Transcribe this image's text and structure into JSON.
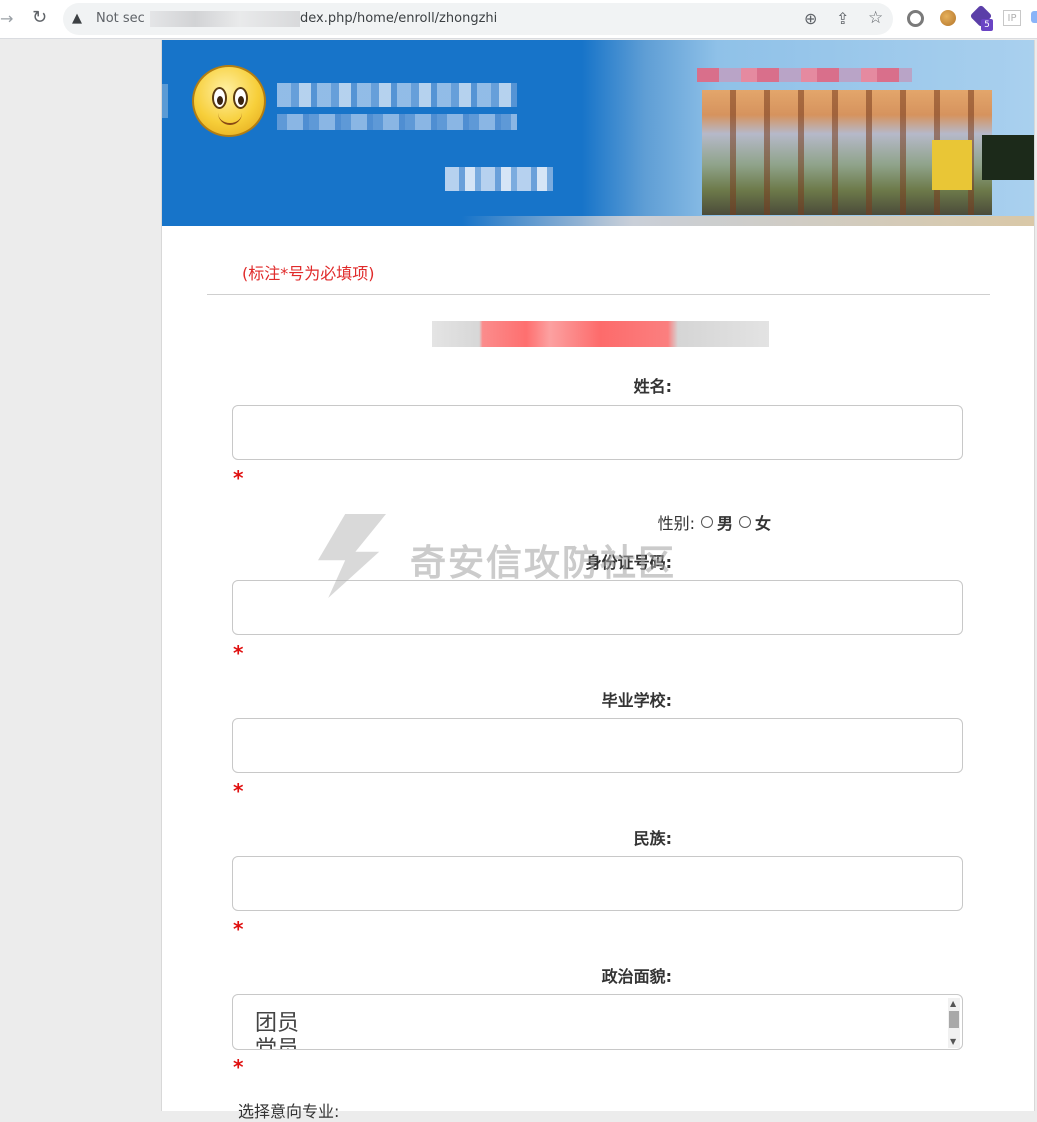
{
  "browser": {
    "url_prefix": "Not sec",
    "url_visible": "dex.php/home/enroll/zhongzhi",
    "ext_badge": "5",
    "ext_ip": "IP"
  },
  "form": {
    "note": "(标注*号为必填项)",
    "required_mark": "*",
    "fields": {
      "name_label": "姓名:",
      "id_label": "身份证号码:",
      "school_label": "毕业学校:",
      "ethnicity_label": "民族:",
      "political_label": "政治面貌:"
    },
    "gender": {
      "label": "性别:",
      "options": [
        "男",
        "女"
      ]
    },
    "political_options": [
      "团员",
      "党员"
    ],
    "major_label": "选择意向专业:"
  },
  "watermark": {
    "text": "奇安信攻防社区"
  },
  "colors": {
    "banner_blue": "#1774c9",
    "required_red": "#e01010",
    "note_red": "#e02a2a"
  }
}
